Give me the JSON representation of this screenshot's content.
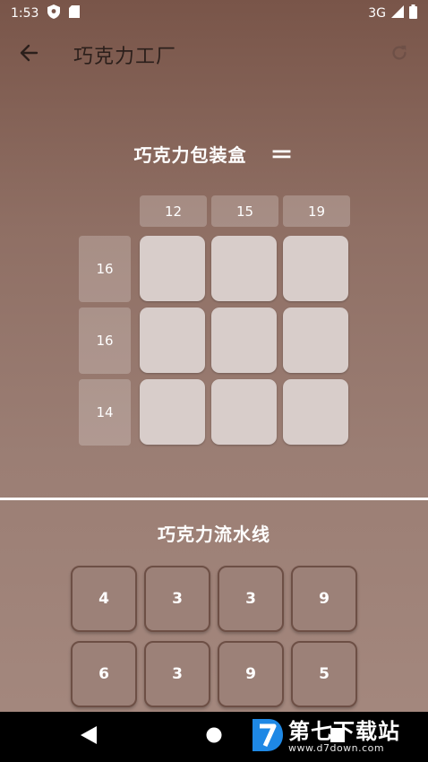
{
  "status_bar": {
    "time": "1:53",
    "network": "3G"
  },
  "app_bar": {
    "title": "巧克力工厂",
    "back_icon": "arrow-back-icon",
    "refresh_icon": "refresh-icon"
  },
  "box": {
    "title": "巧克力包装盒",
    "equals": "＝",
    "col_headers": [
      "12",
      "15",
      "19"
    ],
    "row_headers": [
      "16",
      "16",
      "14"
    ]
  },
  "pipeline": {
    "title": "巧克力流水线",
    "rows": [
      [
        "4",
        "3",
        "3",
        "9"
      ],
      [
        "6",
        "3",
        "9",
        "5"
      ]
    ]
  },
  "watermark": {
    "main": "第七下载站",
    "sub": "www.d7down.com"
  },
  "colors": {
    "bg_top": "#795549",
    "bg_bottom": "#a5897f",
    "cell": "#d8cdca",
    "tile_border": "#6d4f45",
    "watermark_blue": "#1e88e5"
  }
}
